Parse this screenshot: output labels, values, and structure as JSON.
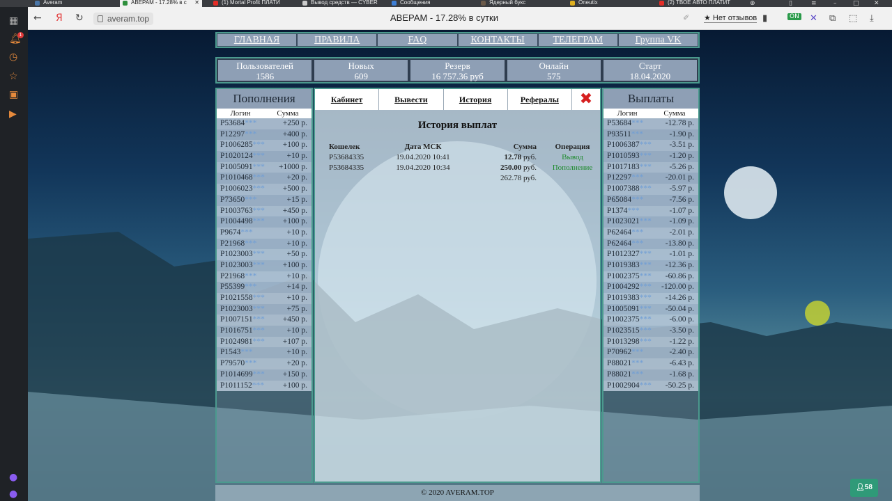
{
  "browser": {
    "tabs": [
      {
        "title": "Averam",
        "active": false
      },
      {
        "title": "АВЕРАМ - 17.28% в с",
        "active": true
      },
      {
        "title": "(1) Mortal Profit ПЛАТИ",
        "active": false
      },
      {
        "title": "Вывод средств — CYBER",
        "active": false
      },
      {
        "title": "Сообщения",
        "active": false
      },
      {
        "title": "Ядерный букс",
        "active": false
      },
      {
        "title": "Oneutix",
        "active": false
      },
      {
        "title": "(2) ТВОЕ АВТО ПЛАТИТ",
        "active": false
      }
    ],
    "url": "averam.top",
    "page_title": "АВЕРАМ - 17.28% в сутки",
    "reviews_label": "★ Нет отзывов",
    "sidebar_badge": "1",
    "ext_badge": "1",
    "users_count": "58"
  },
  "nav": {
    "items": [
      "ГЛАВНАЯ",
      "ПРАВИЛА",
      "FAQ",
      "КОНТАКТЫ",
      "ТЕЛЕГРАМ",
      "Группа VK"
    ]
  },
  "stats": [
    {
      "label": "Пользователей",
      "value": "1586"
    },
    {
      "label": "Новых",
      "value": "609"
    },
    {
      "label": "Резерв",
      "value": "16 757.36 руб"
    },
    {
      "label": "Онлайн",
      "value": "575"
    },
    {
      "label": "Старт",
      "value": "18.04.2020"
    }
  ],
  "deposits": {
    "title": "Пополнения",
    "col_login": "Логин",
    "col_sum": "Сумма",
    "rows": [
      [
        "P53684",
        "***",
        "+250 р."
      ],
      [
        "P12297",
        "***",
        "+400 р."
      ],
      [
        "P1006285",
        "***",
        "+100 р."
      ],
      [
        "P1020124",
        "***",
        "+10 р."
      ],
      [
        "P1005091",
        "***",
        "+1000 р."
      ],
      [
        "P1010468",
        "***",
        "+20 р."
      ],
      [
        "P1006023",
        "***",
        "+500 р."
      ],
      [
        "P73650",
        "***",
        "+15 р."
      ],
      [
        "P1003763",
        "***",
        "+450 р."
      ],
      [
        "P1004498",
        "***",
        "+100 р."
      ],
      [
        "P9674",
        "***",
        "+10 р."
      ],
      [
        "P21968",
        "***",
        "+10 р."
      ],
      [
        "P1023003",
        "***",
        "+50 р."
      ],
      [
        "P1023003",
        "***",
        "+100 р."
      ],
      [
        "P21968",
        "***",
        "+10 р."
      ],
      [
        "P55399",
        "***",
        "+14 р."
      ],
      [
        "P1021558",
        "***",
        "+10 р."
      ],
      [
        "P1023003",
        "***",
        "+75 р."
      ],
      [
        "P1007151",
        "***",
        "+450 р."
      ],
      [
        "P1016751",
        "***",
        "+10 р."
      ],
      [
        "P1024981",
        "***",
        "+107 р."
      ],
      [
        "P1543",
        "***",
        "+10 р."
      ],
      [
        "P79570",
        "***",
        "+20 р."
      ],
      [
        "P1014699",
        "***",
        "+150 р."
      ],
      [
        "P1011152",
        "***",
        "+100 р."
      ]
    ]
  },
  "payouts": {
    "title": "Выплаты",
    "col_login": "Логин",
    "col_sum": "Сумма",
    "rows": [
      [
        "P53684",
        "***",
        "-12.78 р."
      ],
      [
        "P93511",
        "***",
        "-1.90 р."
      ],
      [
        "P1006387",
        "***",
        "-3.51 р."
      ],
      [
        "P1010593",
        "***",
        "-1.20 р."
      ],
      [
        "P1017183",
        "***",
        "-5.26 р."
      ],
      [
        "P12297",
        "***",
        "-20.01 р."
      ],
      [
        "P1007388",
        "***",
        "-5.97 р."
      ],
      [
        "P65084",
        "***",
        "-7.56 р."
      ],
      [
        "P1374",
        "***",
        "-1.07 р."
      ],
      [
        "P1023021",
        "***",
        "-1.09 р."
      ],
      [
        "P62464",
        "***",
        "-2.01 р."
      ],
      [
        "P62464",
        "***",
        "-13.80 р."
      ],
      [
        "P1012327",
        "***",
        "-1.01 р."
      ],
      [
        "P1019383",
        "***",
        "-12.36 р."
      ],
      [
        "P1002375",
        "***",
        "-60.86 р."
      ],
      [
        "P1004292",
        "***",
        "-120.00 р."
      ],
      [
        "P1019383",
        "***",
        "-14.26 р."
      ],
      [
        "P1005091",
        "***",
        "-50.04 р."
      ],
      [
        "P1002375",
        "***",
        "-6.00 р."
      ],
      [
        "P1023515",
        "***",
        "-3.50 р."
      ],
      [
        "P1013298",
        "***",
        "-1.22 р."
      ],
      [
        "P70962",
        "***",
        "-2.40 р."
      ],
      [
        "P88021",
        "***",
        "-6.43 р."
      ],
      [
        "P88021",
        "***",
        "-1.68 р."
      ],
      [
        "P1002904",
        "***",
        "-50.25 р."
      ]
    ]
  },
  "cabinet": {
    "tabs": [
      "Кабинет",
      "Вывести",
      "История",
      "Рефералы"
    ],
    "close_glyph": "✖",
    "title": "История выплат",
    "headers": [
      "Кошелек",
      "Дата МСК",
      "Сумма",
      "Операция"
    ],
    "rows": [
      {
        "wallet": "P53684335",
        "date": "19.04.2020 10:41",
        "amount": "12.78",
        "currency": "руб.",
        "op": "Вывод"
      },
      {
        "wallet": "P53684335",
        "date": "19.04.2020 10:34",
        "amount": "250.00",
        "currency": "руб.",
        "op": "Пополнение"
      }
    ],
    "total": "262.78 руб."
  },
  "footer": "© 2020 AVERAM.TOP"
}
